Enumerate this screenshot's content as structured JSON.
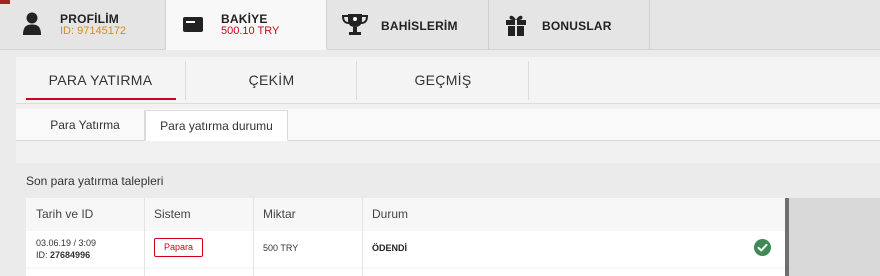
{
  "topnav": {
    "items": [
      {
        "title": "PROFİLİM",
        "sub": "ID: 97145172",
        "icon": "user-icon",
        "sub_color": "#d58d1b"
      },
      {
        "title": "BAKİYE",
        "sub": "500.10 TRY",
        "icon": "wallet-icon",
        "sub_color": "#d0021b"
      },
      {
        "title": "BAHİSLERİM",
        "icon": "trophy-icon"
      },
      {
        "title": "BONUSLAR",
        "icon": "gift-icon"
      }
    ]
  },
  "tabs": [
    {
      "label": "PARA YATIRMA"
    },
    {
      "label": "ÇEKİM"
    },
    {
      "label": "GEÇMİŞ"
    }
  ],
  "subtabs": [
    {
      "label": "Para Yatırma"
    },
    {
      "label": "Para yatırma durumu"
    }
  ],
  "section": {
    "title": "Son para yatırma talepleri"
  },
  "table": {
    "headers": [
      "Tarih ve ID",
      "Sistem",
      "Miktar",
      "Durum"
    ],
    "rows": [
      {
        "date": "03.06.19 / 3:09",
        "id_label": "ID:",
        "id_value": "27684996",
        "system": "Papara",
        "amount": "500 TRY",
        "status": "ÖDENDİ"
      }
    ]
  },
  "colors": {
    "accent": "#d0021b",
    "status_ok": "#3f8a54",
    "profile_id": "#d58d1b"
  }
}
